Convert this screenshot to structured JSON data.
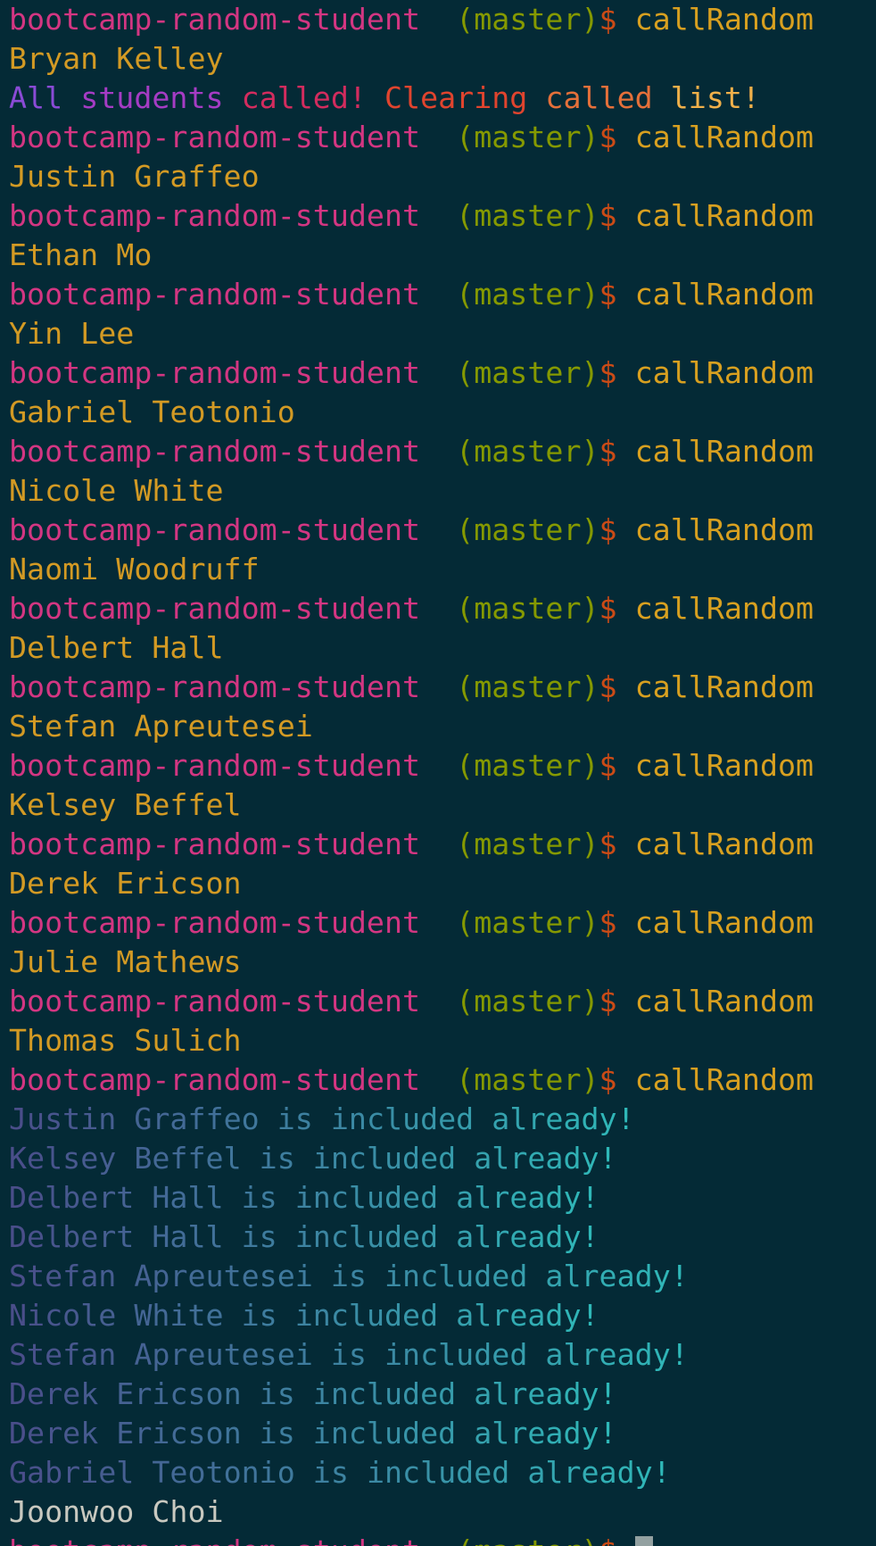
{
  "prompt": {
    "dir": "bootcamp-random-student",
    "gap": "  ",
    "branch": "(master)",
    "dollar": "$ ",
    "command": "callRandom"
  },
  "colors": {
    "background": "#042a36",
    "dir": "#d33682",
    "branch": "#859900",
    "dollar": "#cb4b16",
    "command": "#d8a020",
    "name": "#d39a24",
    "plain": "#c9c9c0",
    "cursor": "#93a1a1"
  },
  "lines": [
    {
      "type": "prompt"
    },
    {
      "type": "name",
      "text": "Bryan Kelley"
    },
    {
      "type": "rainbow",
      "segments": [
        {
          "text": "All ",
          "color": "#8a4bd6"
        },
        {
          "text": "students ",
          "color": "#a53cc4"
        },
        {
          "text": "called! ",
          "color": "#d22c5e"
        },
        {
          "text": "Clearing ",
          "color": "#e0442e"
        },
        {
          "text": "called ",
          "color": "#e5703a"
        },
        {
          "text": "list!",
          "color": "#f0b04a"
        }
      ]
    },
    {
      "type": "prompt"
    },
    {
      "type": "name",
      "text": "Justin Graffeo"
    },
    {
      "type": "prompt"
    },
    {
      "type": "name",
      "text": "Ethan Mo"
    },
    {
      "type": "prompt"
    },
    {
      "type": "name",
      "text": "Yin Lee"
    },
    {
      "type": "prompt"
    },
    {
      "type": "name",
      "text": "Gabriel Teotonio"
    },
    {
      "type": "prompt"
    },
    {
      "type": "name",
      "text": "Nicole White"
    },
    {
      "type": "prompt"
    },
    {
      "type": "name",
      "text": "Naomi Woodruff"
    },
    {
      "type": "prompt"
    },
    {
      "type": "name",
      "text": "Delbert Hall"
    },
    {
      "type": "prompt"
    },
    {
      "type": "name",
      "text": "Stefan Apreutesei"
    },
    {
      "type": "prompt"
    },
    {
      "type": "name",
      "text": "Kelsey Beffel"
    },
    {
      "type": "prompt"
    },
    {
      "type": "name",
      "text": "Derek Ericson"
    },
    {
      "type": "prompt"
    },
    {
      "type": "name",
      "text": "Julie Mathews"
    },
    {
      "type": "prompt"
    },
    {
      "type": "name",
      "text": "Thomas Sulich"
    },
    {
      "type": "prompt"
    },
    {
      "type": "dup",
      "name": "Justin Graffeo",
      "suffix": " is included already!"
    },
    {
      "type": "dup",
      "name": "Kelsey Beffel",
      "suffix": " is included already!"
    },
    {
      "type": "dup",
      "name": "Delbert Hall",
      "suffix": " is included already!"
    },
    {
      "type": "dup",
      "name": "Delbert Hall",
      "suffix": " is included already!"
    },
    {
      "type": "dup",
      "name": "Stefan Apreutesei",
      "suffix": " is included already!"
    },
    {
      "type": "dup",
      "name": "Nicole White",
      "suffix": " is included already!"
    },
    {
      "type": "dup",
      "name": "Stefan Apreutesei",
      "suffix": " is included already!"
    },
    {
      "type": "dup",
      "name": "Derek Ericson",
      "suffix": " is included already!"
    },
    {
      "type": "dup",
      "name": "Derek Ericson",
      "suffix": " is included already!"
    },
    {
      "type": "dup",
      "name": "Gabriel Teotonio",
      "suffix": " is included already!"
    },
    {
      "type": "plain",
      "text": "Joonwoo Choi"
    },
    {
      "type": "prompt-cursor"
    }
  ]
}
